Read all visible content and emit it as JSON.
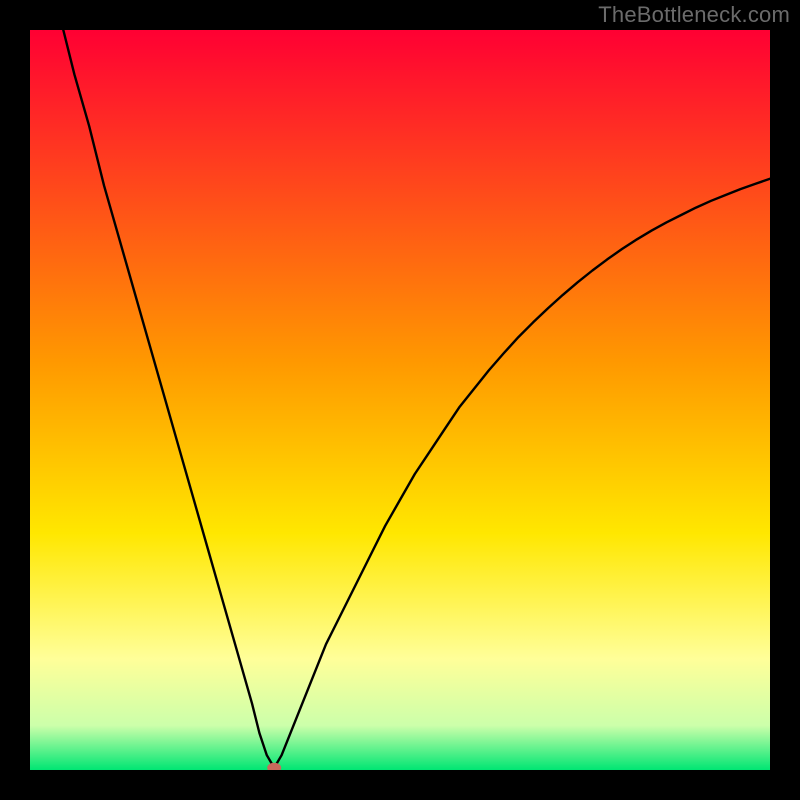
{
  "watermark": "TheBottleneck.com",
  "chart_data": {
    "type": "line",
    "title": "",
    "xlabel": "",
    "ylabel": "",
    "xlim": [
      0,
      100
    ],
    "ylim": [
      0,
      100
    ],
    "x": [
      0,
      2,
      4,
      6,
      8,
      10,
      12,
      14,
      16,
      18,
      20,
      22,
      24,
      26,
      28,
      30,
      31,
      32,
      33,
      34,
      36,
      38,
      40,
      42,
      44,
      46,
      48,
      50,
      52,
      54,
      56,
      58,
      60,
      62,
      64,
      66,
      68,
      70,
      72,
      74,
      76,
      78,
      80,
      82,
      84,
      86,
      88,
      90,
      92,
      94,
      96,
      98,
      100
    ],
    "y": [
      119,
      110,
      102,
      94,
      87,
      79,
      72,
      65,
      58,
      51,
      44,
      37,
      30,
      23,
      16,
      9,
      5,
      2,
      0.3,
      2,
      7,
      12,
      17,
      21,
      25,
      29,
      33,
      36.5,
      40,
      43,
      46,
      49,
      51.5,
      54,
      56.3,
      58.5,
      60.5,
      62.4,
      64.2,
      65.9,
      67.5,
      69,
      70.4,
      71.7,
      72.9,
      74,
      75,
      76,
      76.9,
      77.7,
      78.5,
      79.2,
      79.9
    ],
    "min_point": {
      "x": 33,
      "y": 0.3
    },
    "marker_color": "#c86a5c",
    "curve_color": "#000000",
    "gradient_stops": [
      {
        "offset": "0%",
        "color": "#ff0033"
      },
      {
        "offset": "45%",
        "color": "#ff9900"
      },
      {
        "offset": "68%",
        "color": "#ffe700"
      },
      {
        "offset": "85%",
        "color": "#ffff99"
      },
      {
        "offset": "94%",
        "color": "#ccffaa"
      },
      {
        "offset": "100%",
        "color": "#00e673"
      }
    ]
  }
}
